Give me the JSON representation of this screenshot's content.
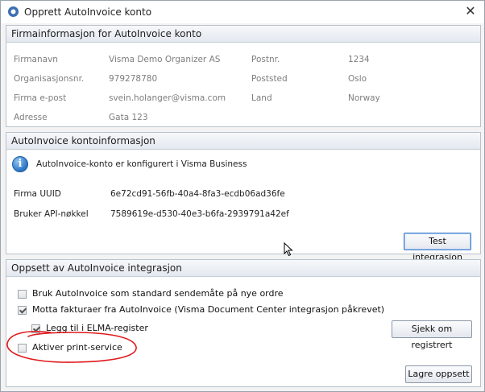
{
  "window": {
    "title": "Opprett AutoInvoice konto",
    "close_symbol": "✕"
  },
  "company_panel": {
    "header": "Firmainformasjon for AutoInvoice konto",
    "fields": {
      "company_name_label": "Firmanavn",
      "company_name_value": "Visma Demo Organizer AS",
      "org_no_label": "Organisasjonsnr.",
      "org_no_value": "979278780",
      "email_label": "Firma e-post",
      "email_value": "svein.holanger@visma.com",
      "address_label": "Adresse",
      "address_value": "Gata 123",
      "postal_no_label": "Postnr.",
      "postal_no_value": "1234",
      "postal_place_label": "Poststed",
      "postal_place_value": "Oslo",
      "country_label": "Land",
      "country_value": "Norway"
    }
  },
  "account_panel": {
    "header": "AutoInvoice kontoinformasjon",
    "info_message": "AutoInvoice-konto er konfigurert i Visma Business",
    "firm_uuid_label": "Firma UUID",
    "firm_uuid_value": "6e72cd91-56fb-40a4-8fa3-ecdb06ad36fe",
    "api_key_label": "Bruker API-nøkkel",
    "api_key_value": "7589619e-d530-40e3-b6fa-2939791a42ef",
    "test_button": "Test integrasjon"
  },
  "setup_panel": {
    "header": "Oppsett av AutoInvoice integrasjon",
    "options": [
      {
        "label": "Bruk AutoInvoice som standard sendemåte på nye ordre",
        "checked": false
      },
      {
        "label": "Motta fakturaer fra AutoInvoice (Visma Document Center integrasjon påkrevet)",
        "checked": true
      },
      {
        "label": "Legg til i ELMA-register",
        "checked": true
      },
      {
        "label": "Aktiver print-service",
        "checked": false
      }
    ],
    "check_registered_button": "Sjekk om registrert",
    "save_button": "Lagre oppsett"
  },
  "colors": {
    "annotation_circle": "#e0191b",
    "accent_focus": "#3f7ecf"
  }
}
